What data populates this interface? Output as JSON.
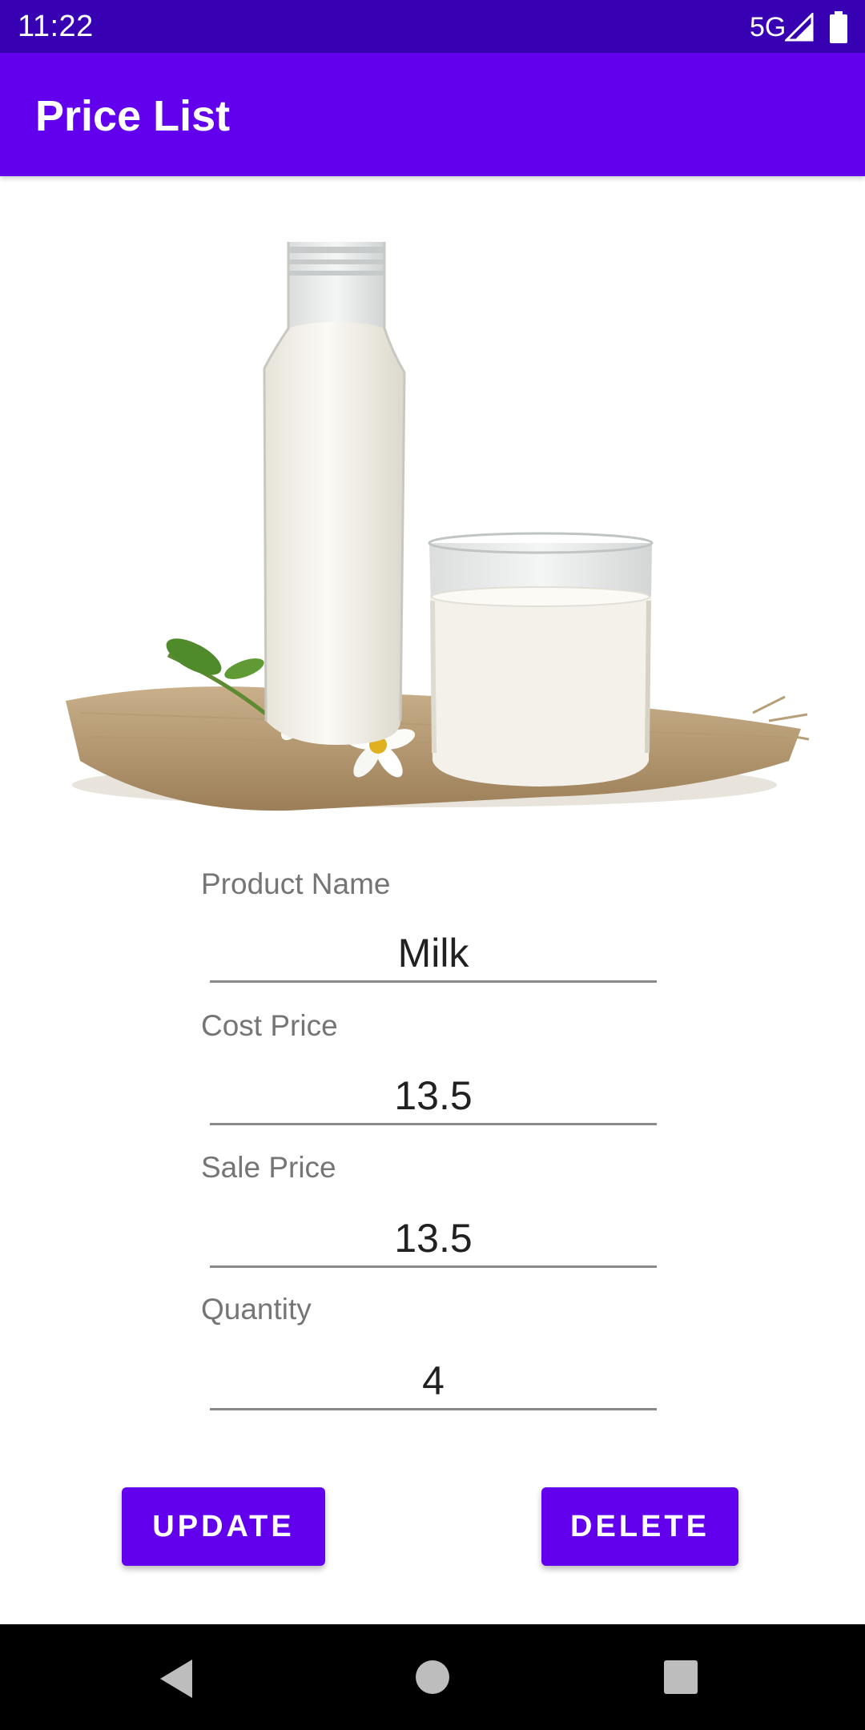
{
  "status_bar": {
    "time": "11:22",
    "network": "5G",
    "signal_icon": "signal-icon",
    "battery_icon": "battery-icon"
  },
  "app_bar": {
    "title": "Price List"
  },
  "product_image": {
    "icon": "milk-bottle-and-glass-image"
  },
  "form": {
    "product_name": {
      "label": "Product Name",
      "value": "Milk"
    },
    "cost_price": {
      "label": "Cost Price",
      "value": "13.5"
    },
    "sale_price": {
      "label": "Sale Price",
      "value": "13.5"
    },
    "quantity": {
      "label": "Quantity",
      "value": "4"
    }
  },
  "actions": {
    "update_label": "UPDATE",
    "delete_label": "DELETE"
  },
  "nav_bar": {
    "back_icon": "back-icon",
    "home_icon": "home-icon",
    "recents_icon": "recents-icon"
  },
  "colors": {
    "status_bar": "#3700b3",
    "primary": "#6200ee",
    "label_text": "#757575",
    "value_text": "#212121",
    "nav_bar": "#000000"
  }
}
